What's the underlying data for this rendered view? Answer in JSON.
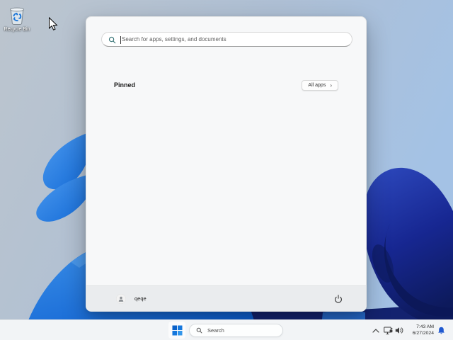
{
  "colors": {
    "accent": "#0f6fd6",
    "bell-blue": "#1f58cf",
    "sky-left": "#bac4cf",
    "sky-right": "#a6c3e4",
    "petal-bright": "#1d74e0",
    "petal-dark": "#152371",
    "menu-bg": "#f7f8f9",
    "menu-footer-bg": "#eaecee",
    "taskbar-bg": "#f2f4f6"
  },
  "desktop": {
    "recycle_bin": {
      "label": "Recycle Bin"
    }
  },
  "start_menu": {
    "search": {
      "placeholder": "Search for apps, settings, and documents"
    },
    "pinned": {
      "title": "Pinned",
      "all_apps_label": "All apps",
      "chevron": "›"
    },
    "footer": {
      "username": "qeqe"
    }
  },
  "taskbar": {
    "search_label": "Search",
    "tray": {
      "time": "7:43 AM",
      "date": "6/27/2024"
    }
  }
}
